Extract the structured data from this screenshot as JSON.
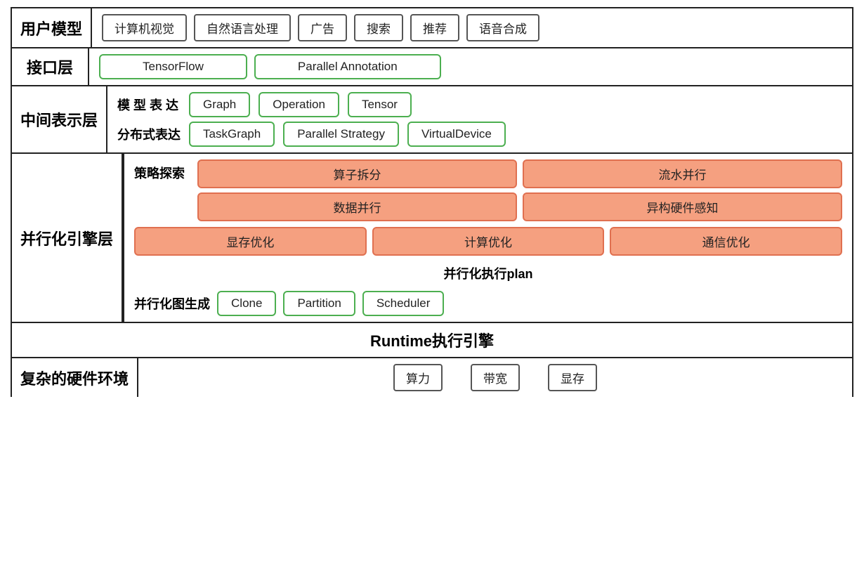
{
  "rows": {
    "user_model": {
      "label": "用户模型",
      "items": [
        "计算机视觉",
        "自然语言处理",
        "广告",
        "搜索",
        "推荐",
        "语音合成"
      ]
    },
    "interface": {
      "label": "接口层",
      "items": [
        "TensorFlow",
        "Parallel Annotation"
      ]
    },
    "intermediate": {
      "label": "中间表示层",
      "model_expr_label": "模 型 表 达",
      "model_expr_items": [
        "Graph",
        "Operation",
        "Tensor"
      ],
      "dist_expr_label": "分布式表达",
      "dist_expr_items": [
        "TaskGraph",
        "Parallel Strategy",
        "VirtualDevice"
      ]
    },
    "parallel_engine": {
      "label": "并行化引擎层",
      "strategy_label": "策略探索",
      "strategy_row1": [
        "算子拆分",
        "流水并行"
      ],
      "strategy_row2": [
        "数据并行",
        "异构硬件感知"
      ],
      "opt_items": [
        "显存优化",
        "计算优化",
        "通信优化"
      ],
      "plan_label": "并行化执行plan",
      "graph_gen_label": "并行化图生成",
      "graph_gen_items": [
        "Clone",
        "Partition",
        "Scheduler"
      ]
    },
    "runtime": {
      "label": "Runtime执行引擎"
    },
    "hardware": {
      "label": "复杂的硬件环境",
      "items": [
        "算力",
        "带宽",
        "显存"
      ]
    }
  }
}
